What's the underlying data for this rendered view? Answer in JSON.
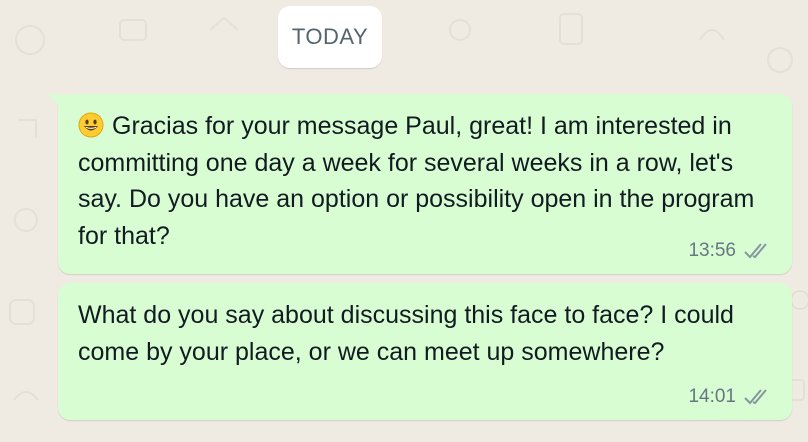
{
  "chat": {
    "day_separator": "TODAY",
    "messages": [
      {
        "emoji": "grinning-face",
        "text": "Gracias for your message Paul, great! I am interested in committing one day a week for several weeks in a row, let's say. Do you have an option or possibility open in the program for that?",
        "time": "13:56",
        "status": "read-double-check-icon"
      },
      {
        "text": "What do you say about discussing this face to face? I could come by your place, or we can meet up somewhere?",
        "time": "14:01",
        "status": "read-double-check-icon"
      }
    ]
  },
  "colors": {
    "wallpaper": "#efeae2",
    "outgoing_bubble": "#d9fdd3",
    "text": "#111b21",
    "meta_text": "#667781",
    "day_chip_text": "#54656f"
  }
}
